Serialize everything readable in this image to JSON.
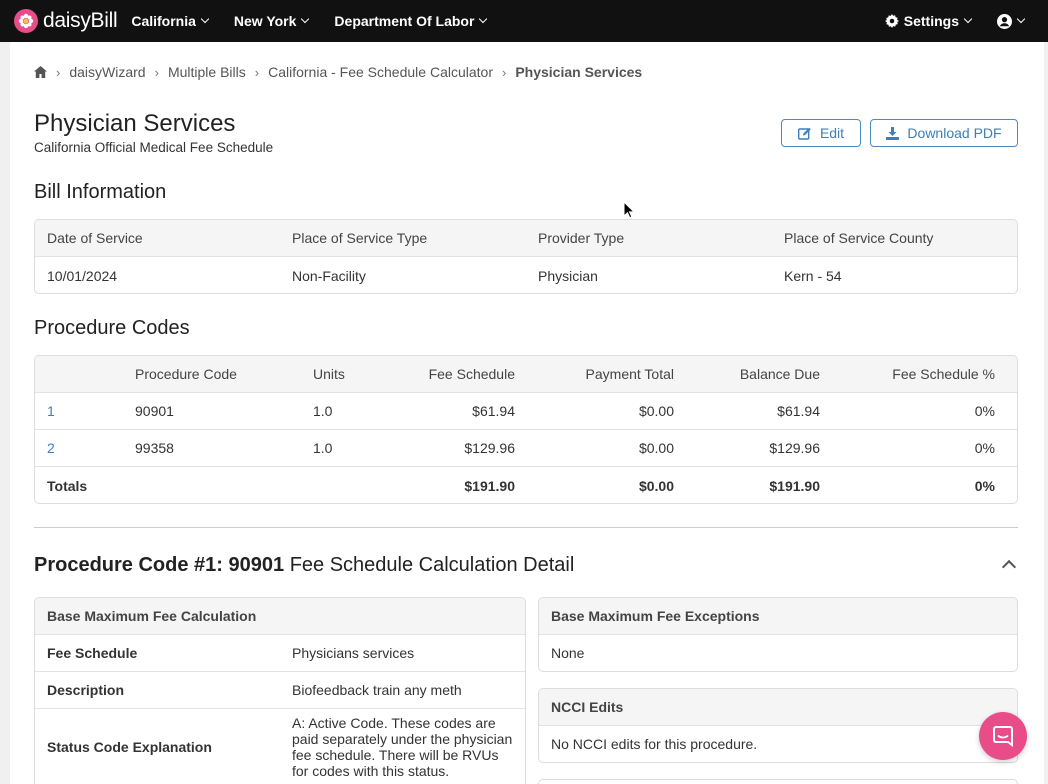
{
  "topbar": {
    "logo_text": "daisyBill",
    "nav": [
      {
        "label": "California"
      },
      {
        "label": "New York"
      },
      {
        "label": "Department Of Labor"
      }
    ],
    "settings_label": "Settings"
  },
  "breadcrumb": {
    "items": [
      "daisyWizard",
      "Multiple Bills",
      "California - Fee Schedule Calculator"
    ],
    "current": "Physician Services"
  },
  "header": {
    "title": "Physician Services",
    "subtitle": "California Official Medical Fee Schedule",
    "edit_label": "Edit",
    "download_label": "Download PDF"
  },
  "bill_info": {
    "title": "Bill Information",
    "columns": [
      "Date of Service",
      "Place of Service Type",
      "Provider Type",
      "Place of Service County"
    ],
    "values": [
      "10/01/2024",
      "Non-Facility",
      "Physician",
      "Kern - 54"
    ]
  },
  "procedure_codes": {
    "title": "Procedure Codes",
    "columns": [
      "",
      "Procedure Code",
      "Units",
      "Fee Schedule",
      "Payment Total",
      "Balance Due",
      "Fee Schedule %"
    ],
    "rows": [
      [
        "1",
        "90901",
        "1.0",
        "$61.94",
        "$0.00",
        "$61.94",
        "0%"
      ],
      [
        "2",
        "99358",
        "1.0",
        "$129.96",
        "$0.00",
        "$129.96",
        "0%"
      ]
    ],
    "totals": [
      "Totals",
      "",
      "",
      "$191.90",
      "$0.00",
      "$191.90",
      "0%"
    ]
  },
  "detail": {
    "title_prefix": "Procedure Code #1: 90901",
    "title_suffix": "Fee Schedule Calculation Detail",
    "base_calc": {
      "title": "Base Maximum Fee Calculation",
      "rows": [
        {
          "k": "Fee Schedule",
          "v": "Physicians services"
        },
        {
          "k": "Description",
          "v": "Biofeedback train any meth"
        },
        {
          "k": "Status Code Explanation",
          "v": "A: Active Code. These codes are paid separately under the physician fee schedule. There will be RVUs for codes with this status."
        }
      ]
    },
    "exceptions": {
      "title": "Base Maximum Fee Exceptions",
      "value": "None"
    },
    "ncci": {
      "title": "NCCI Edits",
      "value": "No NCCI edits for this procedure."
    }
  },
  "colors": {
    "brand": "#e84d8a",
    "link": "#3d7fb8",
    "topbar": "#111111"
  }
}
